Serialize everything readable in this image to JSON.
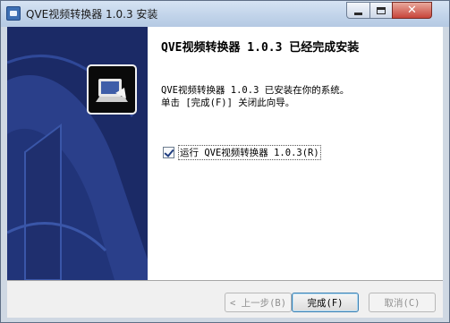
{
  "window": {
    "title": "QVE视频转换器 1.0.3 安装",
    "controls": [
      "minimize-icon",
      "maximize-icon",
      "close-icon"
    ],
    "close_glyph": "✕"
  },
  "content": {
    "heading": "QVE视频转换器 1.0.3 已经完成安装",
    "line1": "QVE视频转换器 1.0.3 已安装在你的系统。",
    "line2": "单击 [完成(F)] 关闭此向导。",
    "run_checkbox": {
      "label": "运行 QVE视频转换器 1.0.3(R)",
      "checked": true
    }
  },
  "buttons": {
    "back": "< 上一步(B)",
    "finish": "完成(F)",
    "cancel": "取消(C)"
  },
  "colors": {
    "sidebar": "#1b2a66",
    "accent": "#3c7fb1"
  }
}
